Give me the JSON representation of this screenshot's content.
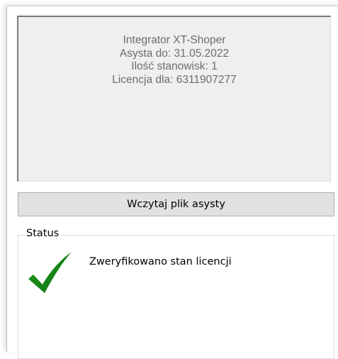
{
  "info": {
    "lines": [
      "Integrator XT-Shoper",
      "Asysta do: 31.05.2022",
      "Ilość stanowisk: 1",
      "Licencja dla: 6311907277"
    ]
  },
  "load_button": {
    "label": "Wczytaj plik asysty"
  },
  "status": {
    "legend": "Status",
    "message": "Zweryfikowano stan licencji",
    "icon": "checkmark-icon",
    "icon_color": "#1a8a1a"
  }
}
